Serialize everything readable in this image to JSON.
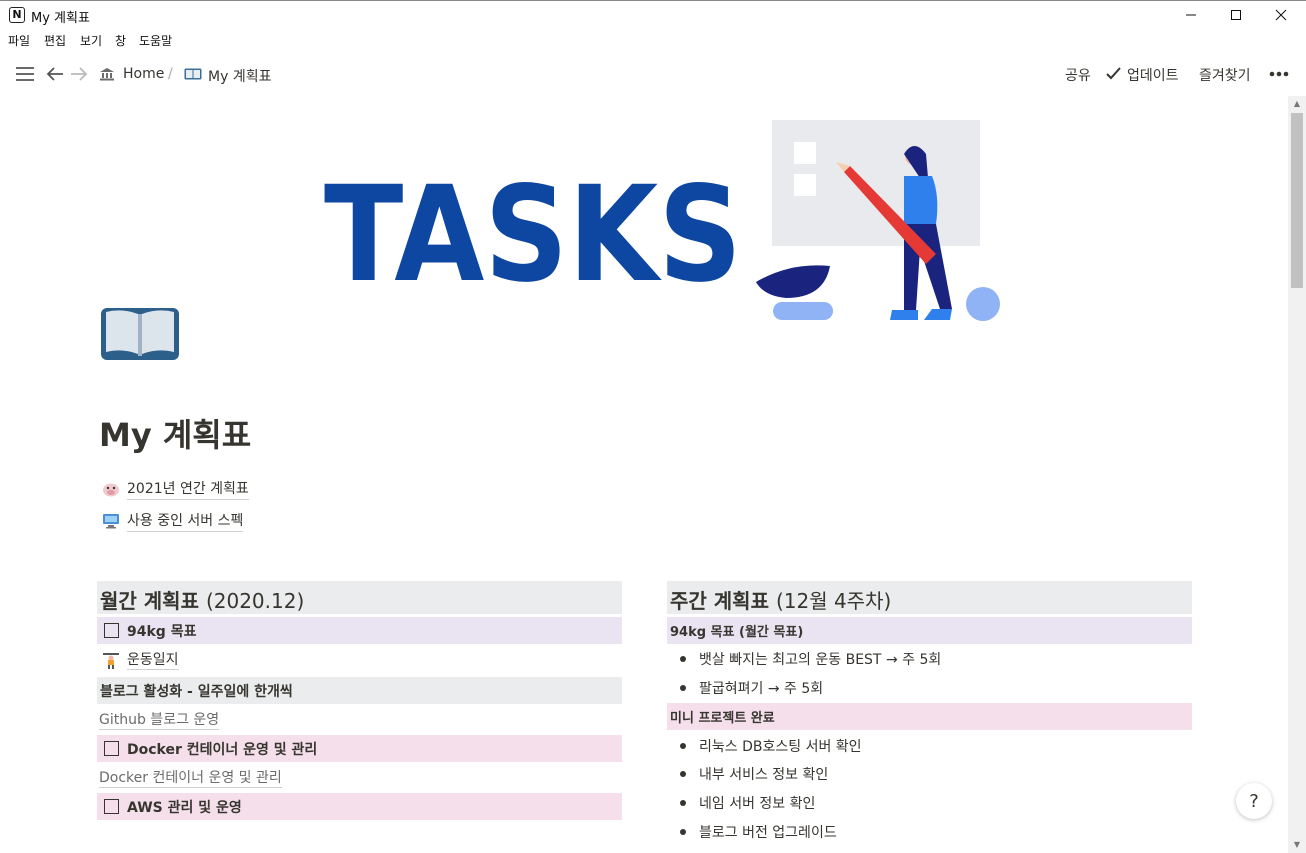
{
  "window": {
    "title": "My 계획표",
    "app_logo_letter": "N",
    "menu": [
      "파일",
      "편집",
      "보기",
      "창",
      "도움말"
    ]
  },
  "topbar": {
    "breadcrumb": {
      "home": "Home",
      "separator": "/",
      "current": "My 계획표"
    },
    "actions": {
      "share": "공유",
      "updates": "업데이트",
      "favorite": "즐겨찾기"
    }
  },
  "cover": {
    "text": "TASKS"
  },
  "page": {
    "title": "My 계획표",
    "links": [
      {
        "icon": "cow-icon",
        "label": "2021년 연간 계획표"
      },
      {
        "icon": "computer-icon",
        "label": "사용 중인 서버 스펙"
      }
    ]
  },
  "monthly": {
    "heading_main": "월간 계획표",
    "heading_sub": "(2020.12)",
    "todo_weight": "94kg 목표",
    "workout_log": "운동일지",
    "blog_heading": "블로그 활성화 - 일주일에 한개씩",
    "github_link": "Github 블로그 운영",
    "todo_docker": "Docker 컨테이너 운영 및 관리",
    "docker_link": "Docker 컨테이너 운영 및 관리",
    "todo_aws": "AWS 관리 및 운영"
  },
  "weekly": {
    "heading_main": "주간 계획표",
    "heading_sub": "(12월 4주차)",
    "weight_heading": "94kg 목표 (월간 목표)",
    "weight_items": [
      "뱃살 빠지는 최고의 운동 BEST → 주 5회",
      "팔굽혀펴기 → 주 5회"
    ],
    "project_heading": "미니 프로젝트 완료",
    "project_items": [
      "리눅스 DB호스팅 서버 확인",
      "내부 서비스 정보 확인",
      "네임 서버 정보 확인",
      "블로그 버전 업그레이드"
    ]
  },
  "help": {
    "label": "?"
  },
  "colors": {
    "text": "#37352f",
    "purple_bg": "#eae4f2",
    "pink_bg": "#f4dfeb",
    "gray_bg": "#ebeced",
    "tasks_blue": "#0d47a1"
  }
}
